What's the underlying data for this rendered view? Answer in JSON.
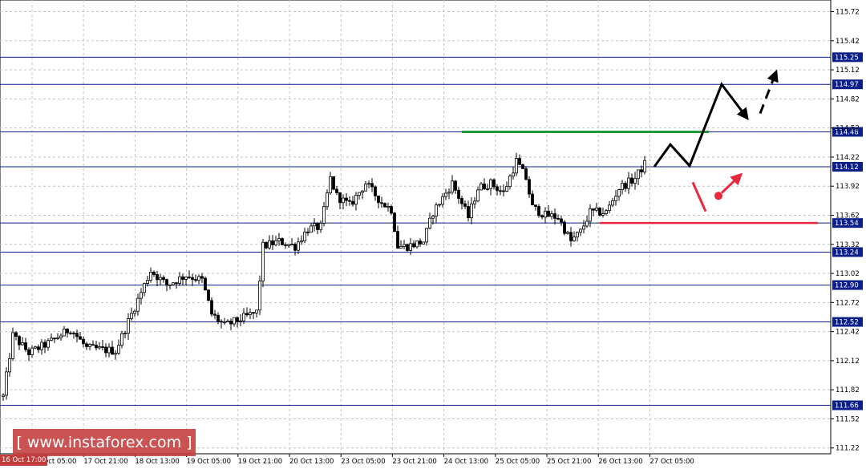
{
  "chart_data": {
    "type": "candlestick",
    "x_labels": [
      "17 Oct 05:00",
      "17 Oct 21:00",
      "18 Oct 13:00",
      "19 Oct 05:00",
      "19 Oct 21:00",
      "20 Oct 13:00",
      "23 Oct 05:00",
      "23 Oct 21:00",
      "24 Oct 13:00",
      "25 Oct 05:00",
      "25 Oct 21:00",
      "26 Oct 13:00",
      "27 Oct 05:00"
    ],
    "x_start_label": "16 Oct 17:00",
    "y_ticks": [
      "115.72",
      "115.42",
      "115.12",
      "114.82",
      "114.52",
      "114.22",
      "113.92",
      "113.62",
      "113.32",
      "113.02",
      "112.72",
      "112.42",
      "112.12",
      "111.82",
      "111.52",
      "111.22"
    ],
    "ylim": [
      111.16,
      115.84
    ],
    "level_lines": [
      {
        "value": 115.25,
        "label": "115.25"
      },
      {
        "value": 114.97,
        "label": "114.97"
      },
      {
        "value": 114.48,
        "label": "114.48"
      },
      {
        "value": 114.12,
        "label": "114.12"
      },
      {
        "value": 113.54,
        "label": "113.54"
      },
      {
        "value": 113.24,
        "label": "113.24"
      },
      {
        "value": 112.9,
        "label": "112.90"
      },
      {
        "value": 112.52,
        "label": "112.52"
      },
      {
        "value": 111.66,
        "label": "111.66"
      }
    ],
    "green_line": {
      "value": 114.48,
      "from_bar": 143,
      "to_bar": 220
    },
    "red_line": {
      "value": 113.54,
      "from_bar": 186,
      "to_bar": 254
    },
    "anchors": [
      {
        "bar": 0,
        "price": 111.75
      },
      {
        "bar": 3,
        "price": 112.38
      },
      {
        "bar": 8,
        "price": 112.2
      },
      {
        "bar": 14,
        "price": 112.3
      },
      {
        "bar": 21,
        "price": 112.45
      },
      {
        "bar": 26,
        "price": 112.25
      },
      {
        "bar": 35,
        "price": 112.22
      },
      {
        "bar": 40,
        "price": 112.6
      },
      {
        "bar": 46,
        "price": 113.05
      },
      {
        "bar": 51,
        "price": 112.9
      },
      {
        "bar": 57,
        "price": 113.0
      },
      {
        "bar": 62,
        "price": 112.95
      },
      {
        "bar": 65,
        "price": 112.6
      },
      {
        "bar": 69,
        "price": 112.48
      },
      {
        "bar": 74,
        "price": 112.55
      },
      {
        "bar": 79,
        "price": 112.62
      },
      {
        "bar": 81,
        "price": 113.3
      },
      {
        "bar": 86,
        "price": 113.35
      },
      {
        "bar": 91,
        "price": 113.3
      },
      {
        "bar": 95,
        "price": 113.48
      },
      {
        "bar": 99,
        "price": 113.5
      },
      {
        "bar": 102,
        "price": 114.0
      },
      {
        "bar": 104,
        "price": 113.82
      },
      {
        "bar": 108,
        "price": 113.72
      },
      {
        "bar": 113,
        "price": 113.95
      },
      {
        "bar": 118,
        "price": 113.75
      },
      {
        "bar": 121,
        "price": 113.68
      },
      {
        "bar": 123,
        "price": 113.3
      },
      {
        "bar": 126,
        "price": 113.3
      },
      {
        "bar": 131,
        "price": 113.35
      },
      {
        "bar": 134,
        "price": 113.65
      },
      {
        "bar": 140,
        "price": 113.95
      },
      {
        "bar": 145,
        "price": 113.6
      },
      {
        "bar": 148,
        "price": 113.9
      },
      {
        "bar": 152,
        "price": 113.95
      },
      {
        "bar": 156,
        "price": 113.85
      },
      {
        "bar": 160,
        "price": 114.18
      },
      {
        "bar": 163,
        "price": 114.0
      },
      {
        "bar": 165,
        "price": 113.7
      },
      {
        "bar": 169,
        "price": 113.62
      },
      {
        "bar": 173,
        "price": 113.6
      },
      {
        "bar": 177,
        "price": 113.35
      },
      {
        "bar": 180,
        "price": 113.45
      },
      {
        "bar": 183,
        "price": 113.65
      },
      {
        "bar": 188,
        "price": 113.65
      },
      {
        "bar": 192,
        "price": 113.9
      },
      {
        "bar": 197,
        "price": 114.0
      },
      {
        "bar": 200,
        "price": 114.15
      }
    ],
    "black_path": [
      [
        203,
        114.12
      ],
      [
        208,
        114.35
      ],
      [
        214,
        114.13
      ],
      [
        224,
        114.97
      ],
      [
        232,
        114.62
      ]
    ],
    "black_dashed": [
      [
        236,
        114.67
      ],
      [
        241,
        115.1
      ]
    ],
    "red_stroke": [
      [
        215,
        113.96
      ],
      [
        219,
        113.66
      ]
    ],
    "red_dot": {
      "bar": 223,
      "price": 113.82
    },
    "red_arrow": [
      [
        224,
        113.85
      ],
      [
        230,
        114.04
      ]
    ]
  },
  "watermark": {
    "text": "[ www.instaforex.com ]"
  },
  "colors": {
    "bullish": "#000000",
    "bearish": "#000000",
    "level_line": "#0b1f8a",
    "badge_bg": "#0b1f8a",
    "green": "#1e9a3c",
    "red": "#e8283c",
    "grid": "#c4c4c4"
  }
}
